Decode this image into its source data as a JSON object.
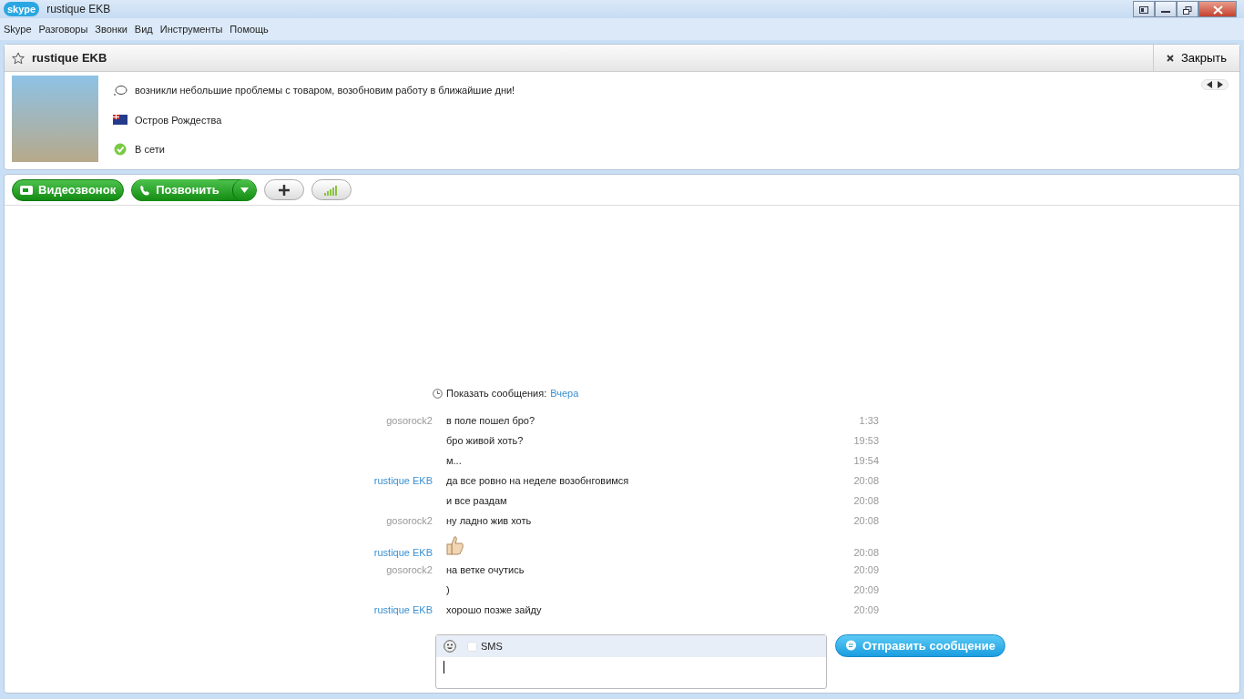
{
  "window": {
    "title": "rustique EKB",
    "logo": "skype"
  },
  "menu": [
    "Skype",
    "Разговоры",
    "Звонки",
    "Вид",
    "Инструменты",
    "Помощь"
  ],
  "contact": {
    "name": "rustique EKB",
    "favorite": false,
    "close_label": "Закрыть",
    "mood": "возникли небольшие проблемы с товаром, возобновим работу в ближайшие дни!",
    "location": "Остров Рождества",
    "status": "В сети"
  },
  "toolbar": {
    "video_call": "Видеозвонок",
    "call": "Позвонить"
  },
  "history": {
    "label": "Показать сообщения:",
    "link": "Вчера"
  },
  "messages": [
    {
      "sender": {
        "name": "gosorock2",
        "kind": "self"
      },
      "kind": "text",
      "text": "в поле пошел бро?",
      "time": "1:33"
    },
    {
      "kind": "text",
      "text": "бро живой хоть?",
      "time": "19:53"
    },
    {
      "kind": "text",
      "text": "м...",
      "time": "19:54"
    },
    {
      "sender": {
        "name": "rustique EKB",
        "kind": "contact"
      },
      "kind": "text",
      "text": "да все ровно на неделе возобнговимся",
      "time": "20:08"
    },
    {
      "kind": "text",
      "text": "и все раздам",
      "time": "20:08"
    },
    {
      "sender": {
        "name": "gosorock2",
        "kind": "self"
      },
      "kind": "text",
      "text": "ну ладно жив хоть",
      "time": "20:08"
    },
    {
      "sender": {
        "name": "rustique EKB",
        "kind": "contact"
      },
      "kind": "emoticon",
      "time": "20:08"
    },
    {
      "sender": {
        "name": "gosorock2",
        "kind": "self"
      },
      "kind": "text",
      "text": "на ветке очутись",
      "time": "20:09"
    },
    {
      "kind": "text",
      "text": ")",
      "time": "20:09"
    },
    {
      "sender": {
        "name": "rustique EKB",
        "kind": "contact"
      },
      "kind": "text",
      "text": "хорошо позже зайду",
      "time": "20:09"
    }
  ],
  "composer": {
    "sms_label": "SMS",
    "sms_checked": false,
    "send": "Отправить сообщение"
  }
}
